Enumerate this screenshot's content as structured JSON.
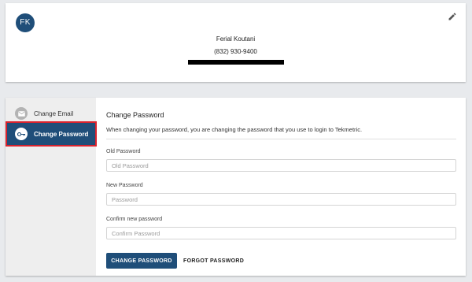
{
  "profile": {
    "initials": "FK",
    "name": "Ferial Koutani",
    "phone": "(832) 930-9400",
    "edit_icon": "pencil-icon"
  },
  "sidebar": {
    "items": [
      {
        "label": "Change Email",
        "icon": "envelope-icon",
        "active": false
      },
      {
        "label": "Change Password",
        "icon": "key-icon",
        "active": true
      }
    ]
  },
  "form": {
    "title": "Change Password",
    "description": "When changing your password, you are changing the password that you use to login to Tekmetric.",
    "fields": [
      {
        "label": "Old Password",
        "placeholder": "Old Password",
        "value": ""
      },
      {
        "label": "New Password",
        "placeholder": "Password",
        "value": ""
      },
      {
        "label": "Confirm new password",
        "placeholder": "Confirm Password",
        "value": ""
      }
    ],
    "submit_label": "CHANGE PASSWORD",
    "forgot_label": "FORGOT PASSWORD"
  },
  "colors": {
    "brand": "#1f4e79",
    "highlight": "#d9232e",
    "background": "#e8eaed"
  }
}
